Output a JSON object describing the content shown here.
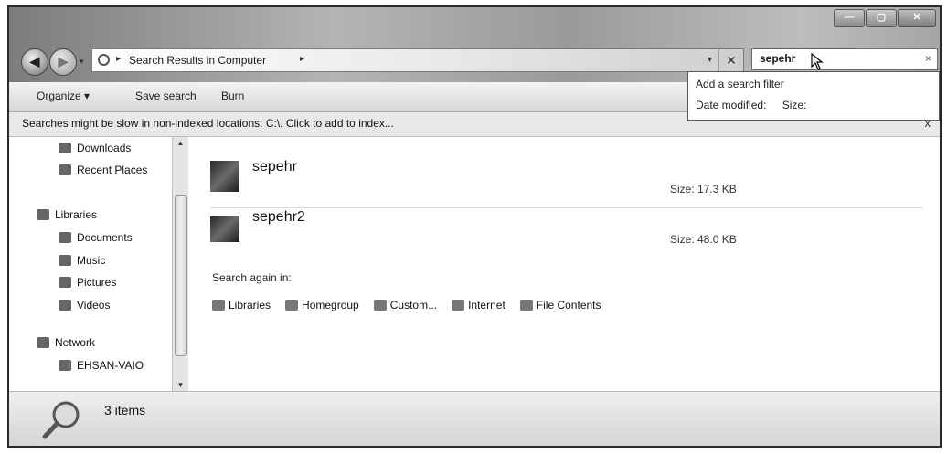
{
  "window_controls": {
    "minimize": "—",
    "maximize": "▢",
    "close": "✕"
  },
  "address": {
    "path_arrow": "▸",
    "path_label": "Search Results in Computer",
    "path_trailing_arrow": "▸",
    "dropdown": "▾",
    "clear_button": "✕"
  },
  "search": {
    "value": "sepehr",
    "clear": "×"
  },
  "filter_popup": {
    "title": "Add a search filter",
    "filters": [
      "Date modified:",
      "Size:"
    ]
  },
  "toolbar": {
    "organize": "Organize ▾",
    "save_search": "Save search",
    "burn": "Burn"
  },
  "infobar": {
    "message": "Searches might be slow in non-indexed locations: C:\\. Click to add to index...",
    "close": "x"
  },
  "sidebar": {
    "items": [
      {
        "label": "Downloads",
        "icon": "downloads-icon"
      },
      {
        "label": "Recent Places",
        "icon": "recent-places-icon"
      },
      {
        "label": "Libraries",
        "icon": "libraries-icon"
      },
      {
        "label": "Documents",
        "icon": "documents-icon"
      },
      {
        "label": "Music",
        "icon": "music-icon"
      },
      {
        "label": "Pictures",
        "icon": "pictures-icon"
      },
      {
        "label": "Videos",
        "icon": "videos-icon"
      },
      {
        "label": "Network",
        "icon": "network-icon"
      },
      {
        "label": "EHSAN-VAIO",
        "icon": "computer-icon"
      }
    ]
  },
  "results": [
    {
      "name": "sepehr",
      "size": "Size: 17.3 KB"
    },
    {
      "name": "sepehr2",
      "size": "Size: 48.0 KB"
    }
  ],
  "search_again": {
    "label": "Search again in:",
    "locations": [
      "Libraries",
      "Homegroup",
      "Custom...",
      "Internet",
      "File Contents"
    ]
  },
  "status": {
    "item_count": "3 items"
  }
}
